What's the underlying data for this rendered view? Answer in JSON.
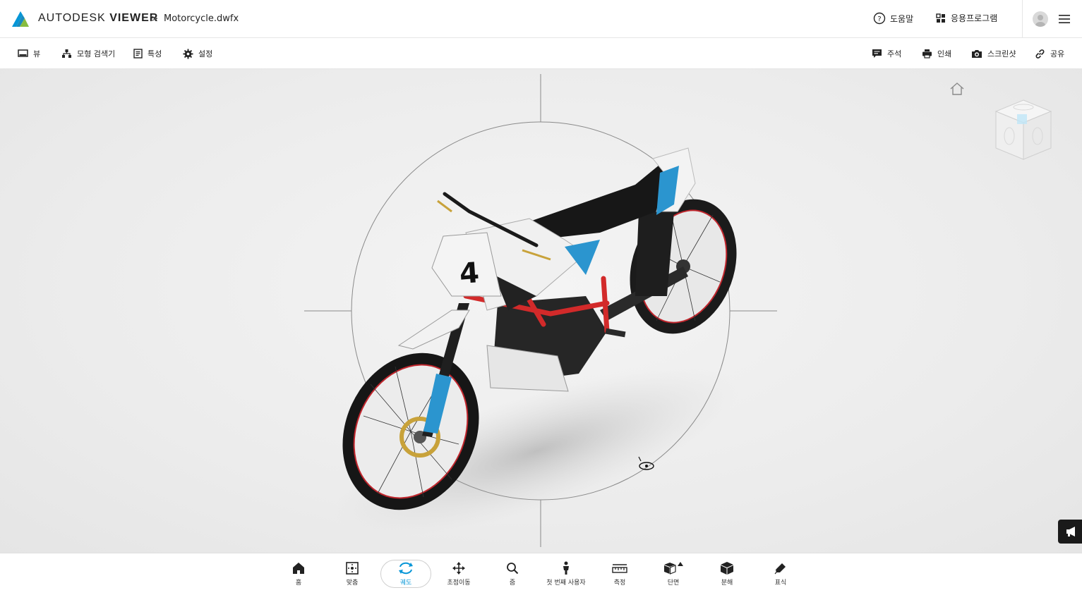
{
  "header": {
    "brand_light": "AUTODESK",
    "brand_bold": "VIEWER",
    "separator": ">",
    "filename": "Motorcycle.dwfx",
    "help_label": "도움말",
    "apps_label": "응용프로그램"
  },
  "toolbar": {
    "left": [
      {
        "label": "뷰",
        "icon": "monitor-icon"
      },
      {
        "label": "모형 검색기",
        "icon": "hierarchy-icon"
      },
      {
        "label": "특성",
        "icon": "properties-icon"
      },
      {
        "label": "설정",
        "icon": "gear-icon"
      }
    ],
    "right": [
      {
        "label": "주석",
        "icon": "comment-icon"
      },
      {
        "label": "인쇄",
        "icon": "print-icon"
      },
      {
        "label": "스크린샷",
        "icon": "camera-icon"
      },
      {
        "label": "공유",
        "icon": "link-icon"
      }
    ]
  },
  "bottom_nav": [
    {
      "label": "홈",
      "icon": "home-icon",
      "active": false
    },
    {
      "label": "맞춤",
      "icon": "fit-icon",
      "active": false
    },
    {
      "label": "궤도",
      "icon": "orbit-icon",
      "active": true
    },
    {
      "label": "초점이동",
      "icon": "pan-icon",
      "active": false
    },
    {
      "label": "줌",
      "icon": "zoom-icon",
      "active": false
    },
    {
      "label": "첫 번째 사용자",
      "icon": "person-icon",
      "active": false
    },
    {
      "label": "측정",
      "icon": "ruler-icon",
      "active": false
    },
    {
      "label": "단면",
      "icon": "section-icon",
      "active": false
    },
    {
      "label": "분해",
      "icon": "explode-icon",
      "active": false
    },
    {
      "label": "표식",
      "icon": "markup-icon",
      "active": false
    }
  ],
  "colors": {
    "accent": "#0696d7",
    "logo_blue": "#0696d7",
    "logo_green": "#87bc40"
  }
}
